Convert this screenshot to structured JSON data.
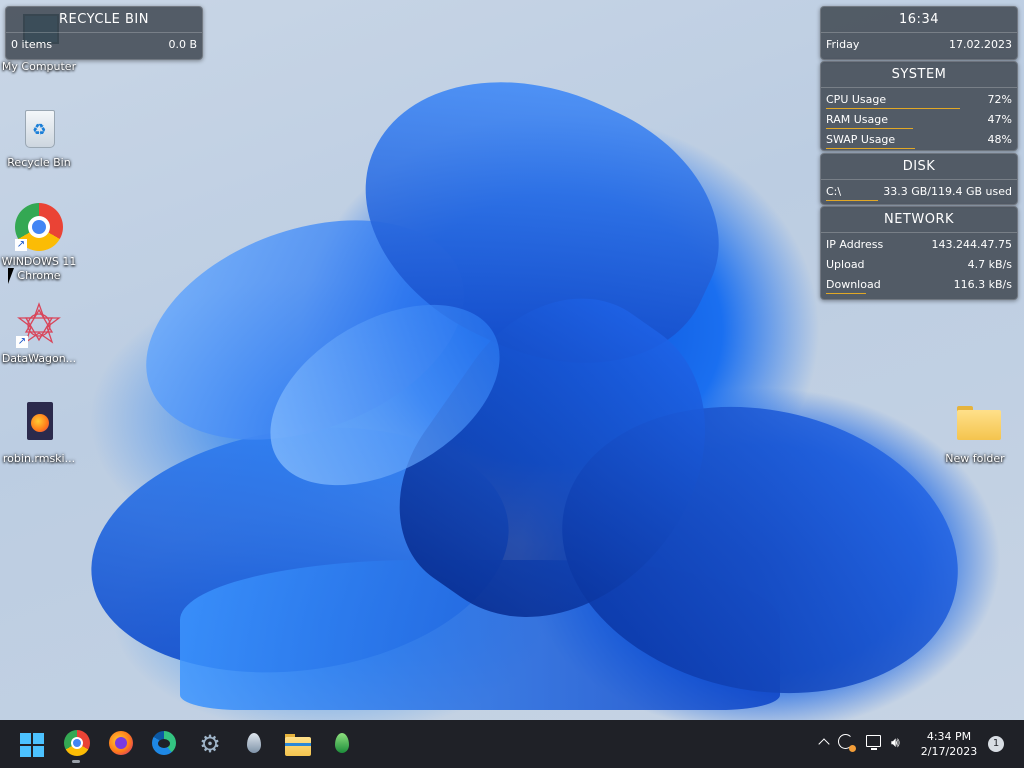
{
  "recycle_widget": {
    "title": "RECYCLE BIN",
    "items": "0 items",
    "size": "0.0 B"
  },
  "clock_widget": {
    "time": "16:34",
    "day": "Friday",
    "date": "17.02.2023"
  },
  "system_widget": {
    "title": "SYSTEM",
    "rows": [
      {
        "label": "CPU Usage",
        "value": "72%",
        "fraction": 0.72
      },
      {
        "label": "RAM Usage",
        "value": "47%",
        "fraction": 0.47
      },
      {
        "label": "SWAP Usage",
        "value": "48%",
        "fraction": 0.48
      }
    ]
  },
  "disk_widget": {
    "title": "DISK",
    "drive": "C:\\",
    "usage": "33.3 GB/119.4 GB used",
    "fraction": 0.279
  },
  "network_widget": {
    "title": "NETWORK",
    "rows": [
      {
        "label": "IP Address",
        "value": "143.244.47.75"
      },
      {
        "label": "Upload",
        "value": "4.7 kB/s"
      },
      {
        "label": "Download",
        "value": "116.3 kB/s"
      }
    ]
  },
  "desktop_icons": {
    "my_computer": "My Computer",
    "recycle_bin": "Recycle Bin",
    "chrome_line1": "WINDOWS 11",
    "chrome_line2": "Chrome",
    "datawagon": "DataWagon...",
    "robin": "robin.rmski...",
    "new_folder": "New folder"
  },
  "taskbar": {
    "time": "4:34 PM",
    "date": "2/17/2023",
    "notification_count": "1"
  },
  "colors": {
    "accent": "#e1a826",
    "taskbar": "#1f2127",
    "widget_bg": "#404852"
  }
}
